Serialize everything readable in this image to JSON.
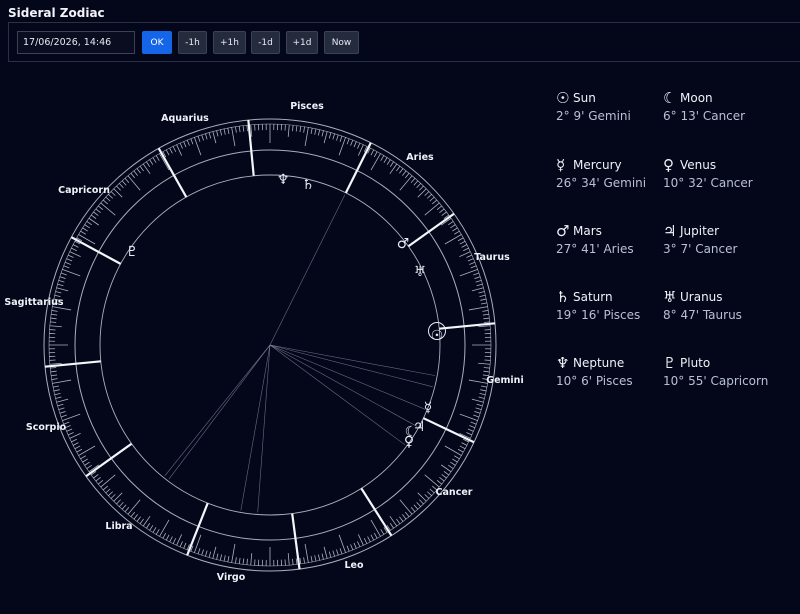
{
  "app": {
    "title": "Sideral Zodiac"
  },
  "controls": {
    "datetime_value": "17/06/2026, 14:46",
    "buttons": [
      {
        "label": "OK",
        "name": "ok-button",
        "primary": true
      },
      {
        "label": "-1h",
        "name": "minus-1h-button"
      },
      {
        "label": "+1h",
        "name": "plus-1h-button"
      },
      {
        "label": "-1d",
        "name": "minus-1d-button"
      },
      {
        "label": "+1d",
        "name": "plus-1d-button"
      },
      {
        "label": "Now",
        "name": "now-button"
      }
    ]
  },
  "wheel": {
    "signs": [
      "Aries",
      "Taurus",
      "Gemini",
      "Cancer",
      "Leo",
      "Virgo",
      "Libra",
      "Scorpio",
      "Sagittarius",
      "Capricorn",
      "Aquarius",
      "Pisces"
    ],
    "cusps_deg": [
      25.5,
      57.5,
      82.5,
      111.5,
      144.5,
      174.5,
      208.5,
      240.5,
      264.5,
      296.5,
      324.5,
      354.5
    ],
    "planet_lines_deg": [
      100.0,
      128.8,
      94.2,
      29.0,
      127.0,
      36.5,
      22.5,
      14.4,
      10.5,
      296.5
    ],
    "glyphs": [
      {
        "symbol": "☉",
        "name": "sun-glyph-icon"
      },
      {
        "symbol": "☾",
        "name": "moon-glyph-icon"
      },
      {
        "symbol": "☿",
        "name": "mercury-glyph-icon"
      },
      {
        "symbol": "♀",
        "name": "venus-glyph-icon"
      },
      {
        "symbol": "♂",
        "name": "mars-glyph-icon"
      },
      {
        "symbol": "♃",
        "name": "jupiter-glyph-icon"
      },
      {
        "symbol": "♄",
        "name": "saturn-glyph-icon"
      },
      {
        "symbol": "♅",
        "name": "uranus-glyph-icon"
      },
      {
        "symbol": "♆",
        "name": "neptune-glyph-icon"
      },
      {
        "symbol": "♇",
        "name": "pluto-glyph-icon"
      }
    ]
  },
  "planets": [
    {
      "name": "Sun",
      "symbol": "☉",
      "position": "2° 9' Gemini",
      "icon": "sun-icon"
    },
    {
      "name": "Moon",
      "symbol": "☾",
      "position": "6° 13' Cancer",
      "icon": "moon-icon"
    },
    {
      "name": "Mercury",
      "symbol": "☿",
      "position": "26° 34' Gemini",
      "icon": "mercury-icon"
    },
    {
      "name": "Venus",
      "symbol": "♀",
      "position": "10° 32' Cancer",
      "icon": "venus-icon"
    },
    {
      "name": "Mars",
      "symbol": "♂",
      "position": "27° 41' Aries",
      "icon": "mars-icon"
    },
    {
      "name": "Jupiter",
      "symbol": "♃",
      "position": "3° 7' Cancer",
      "icon": "jupiter-icon"
    },
    {
      "name": "Saturn",
      "symbol": "♄",
      "position": "19° 16' Pisces",
      "icon": "saturn-icon"
    },
    {
      "name": "Uranus",
      "symbol": "♅",
      "position": "8° 47' Taurus",
      "icon": "uranus-icon"
    },
    {
      "name": "Neptune",
      "symbol": "♆",
      "position": "10° 6' Pisces",
      "icon": "neptune-icon"
    },
    {
      "name": "Pluto",
      "symbol": "♇",
      "position": "10° 55' Capricorn",
      "icon": "pluto-icon"
    }
  ],
  "colors": {
    "background": "#04061a",
    "accent": "#1565e8",
    "ring": "#c8ccd8"
  }
}
